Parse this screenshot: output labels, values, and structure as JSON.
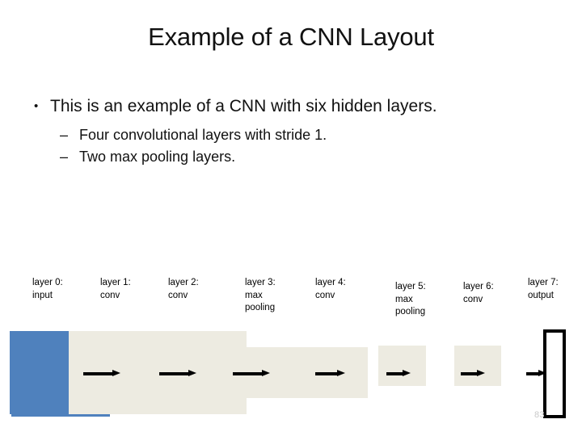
{
  "slide": {
    "title": "Example of a CNN Layout",
    "page_number": "83"
  },
  "bullets": {
    "level1_marker": "•",
    "level2_marker": "–",
    "level1": "This is an example of a CNN with six hidden layers.",
    "level2": [
      "Four convolutional layers with stride 1.",
      "Two max pooling layers."
    ]
  },
  "diagram": {
    "colors": {
      "input_block": "#4F81BD",
      "feature_block": "#EDEBE1",
      "output_border": "#000000",
      "arrow": "#000000",
      "page_number": "#C9C9C9"
    },
    "layers": [
      {
        "id": "layer-0",
        "title": "layer 0:",
        "kind": "input"
      },
      {
        "id": "layer-1",
        "title": "layer 1:",
        "kind": "conv"
      },
      {
        "id": "layer-2",
        "title": "layer 2:",
        "kind": "conv"
      },
      {
        "id": "layer-3",
        "title": "layer 3:",
        "kind": "max\npooling"
      },
      {
        "id": "layer-4",
        "title": "layer 4:",
        "kind": "conv"
      },
      {
        "id": "layer-5",
        "title": "layer 5:",
        "kind": "max\npooling"
      },
      {
        "id": "layer-6",
        "title": "layer 6:",
        "kind": "conv"
      },
      {
        "id": "layer-7",
        "title": "layer 7:",
        "kind": "output"
      }
    ],
    "labels": [
      "layer 0:\ninput",
      "layer 1:\nconv",
      "layer 2:\nconv",
      "layer 3:\nmax\npooling",
      "layer 4:\nconv",
      "layer 5:\nmax\npooling",
      "layer 6:\nconv",
      "layer 7:\noutput"
    ],
    "arrow_count": 7
  }
}
